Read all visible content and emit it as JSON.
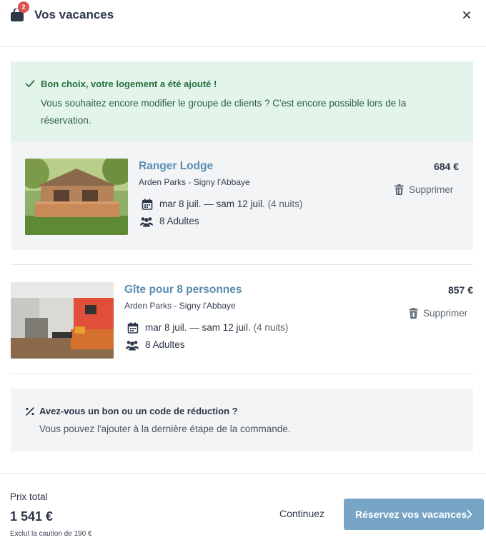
{
  "header": {
    "title": "Vos vacances",
    "cart_count": "2",
    "icons": {
      "cart": "shopping-bag-icon",
      "close": "close-icon"
    }
  },
  "success": {
    "title": "Bon choix, votre logement a été ajouté !",
    "message": "Vous souhaitez encore modifier le groupe de clients ? C'est encore possible lors de la réservation.",
    "icon": "check-icon"
  },
  "items": [
    {
      "name": "Ranger Lodge",
      "location": "Arden Parks - Signy l'Abbaye",
      "dates": "mar 8 juil. — sam 12 juil.",
      "nights": "(4 nuits)",
      "guests": "8 Adultes",
      "price": "684 €",
      "remove_label": "Supprimer"
    },
    {
      "name": "Gîte pour 8 personnes",
      "location": "Arden Parks - Signy l'Abbaye",
      "dates": "mar 8 juil. — sam 12 juil.",
      "nights": "(4 nuits)",
      "guests": "8 Adultes",
      "price": "857 €",
      "remove_label": "Supprimer"
    }
  ],
  "promo": {
    "title": "Avez-vous un bon ou un code de réduction ?",
    "text": "Vous pouvez l'ajouter à la dernière étape de la commande.",
    "icon": "percent-icon"
  },
  "footer": {
    "total_label": "Prix total",
    "total": "1 541 €",
    "deposit_note": "Exclut la caution de 190 €",
    "continue_label": "Continuez",
    "cta_label": "Réservez vos vacances"
  },
  "colors": {
    "accent": "#77a5c6",
    "link": "#5a8db1",
    "success_bg": "#e3f5ea",
    "success_text": "#24703f",
    "badge": "#d9534f"
  }
}
